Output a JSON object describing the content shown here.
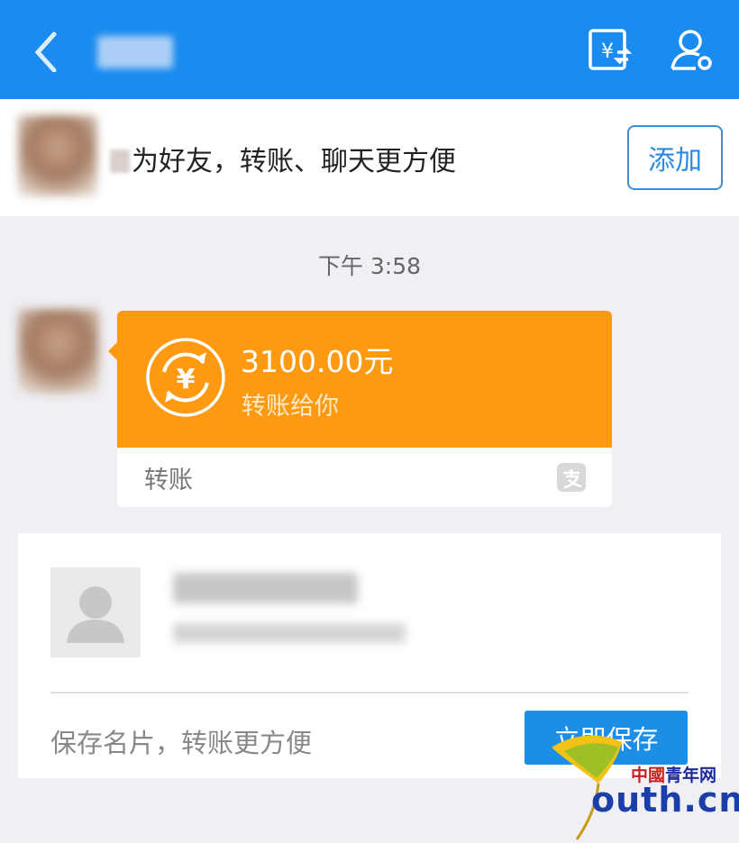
{
  "header": {
    "back_icon": "back-arrow-icon",
    "icons": [
      "transfer-icon",
      "contact-profile-icon"
    ],
    "color": "#1a8cf0"
  },
  "friend_bar": {
    "prompt_text": "为好友，转账、聊天更方便",
    "add_label": "添加"
  },
  "chat": {
    "time": "下午 3:58",
    "transfer_card": {
      "amount": "3100.00元",
      "subtitle": "转账给你",
      "footer_label": "转账",
      "accent": "#fe9a11"
    }
  },
  "name_card": {
    "prompt": "保存名片，转账更方便",
    "save_label": "立即保存",
    "button_color": "#1c8ee6"
  },
  "watermark": {
    "chinese": "中國青年网",
    "english": "outh.cn"
  }
}
